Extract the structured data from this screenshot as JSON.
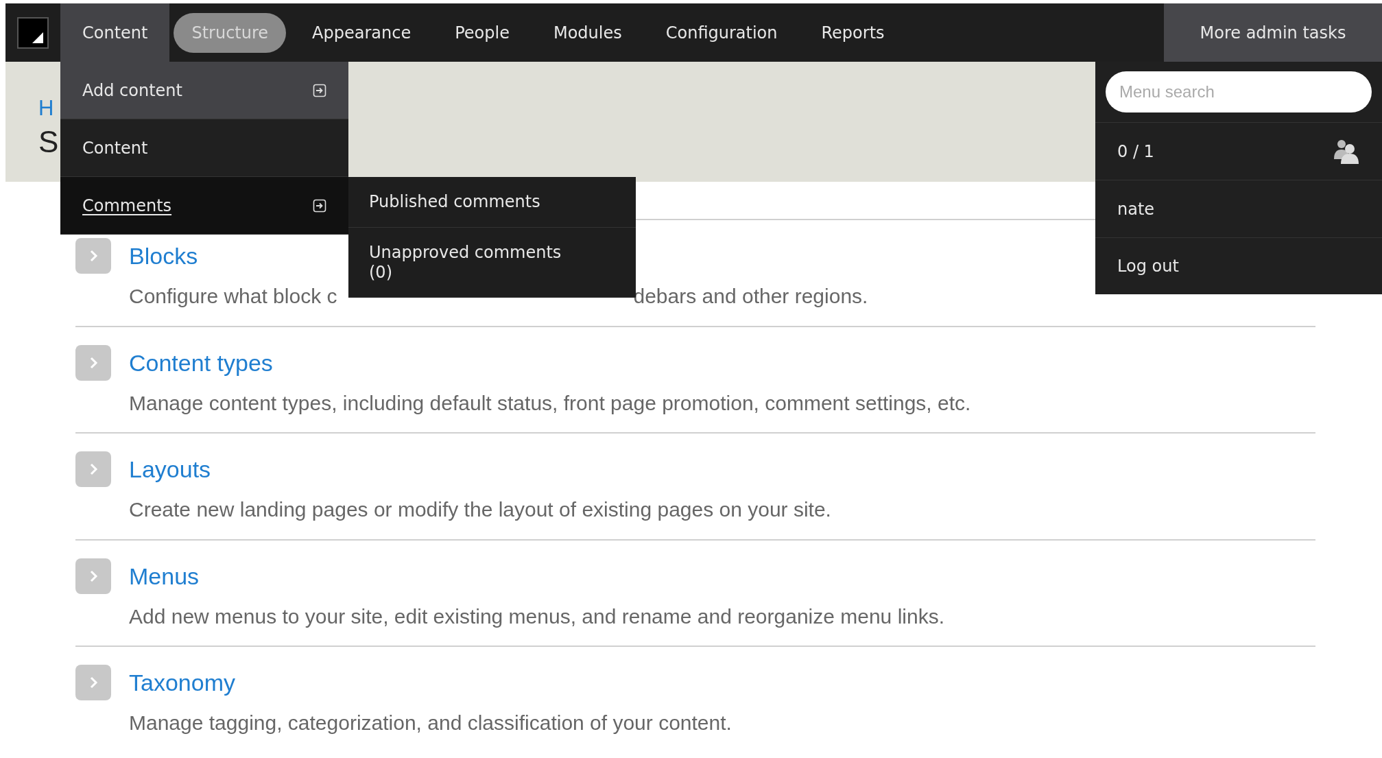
{
  "toolbar": {
    "tabs": [
      {
        "label": "Content",
        "selected": false,
        "expanded": true
      },
      {
        "label": "Structure",
        "selected": true,
        "expanded": false
      },
      {
        "label": "Appearance",
        "selected": false,
        "expanded": false
      },
      {
        "label": "People",
        "selected": false,
        "expanded": false
      },
      {
        "label": "Modules",
        "selected": false,
        "expanded": false
      },
      {
        "label": "Configuration",
        "selected": false,
        "expanded": false
      },
      {
        "label": "Reports",
        "selected": false,
        "expanded": false
      }
    ],
    "more": {
      "label": "More admin tasks",
      "expanded": true
    }
  },
  "content_menu": [
    {
      "label": "Add content",
      "has_submenu": true,
      "hovered": true,
      "focused": false
    },
    {
      "label": "Content",
      "has_submenu": false,
      "hovered": false,
      "focused": false
    },
    {
      "label": "Comments",
      "has_submenu": true,
      "hovered": false,
      "focused": true
    }
  ],
  "comments_submenu": [
    {
      "label": "Published comments"
    },
    {
      "label": "Unapproved comments",
      "count": "(0)"
    }
  ],
  "user_panel": {
    "search": {
      "placeholder": "Menu search"
    },
    "sessions": "0 / 1",
    "user": "nate",
    "logout": "Log out"
  },
  "page": {
    "breadcrumb": "H",
    "title": "S",
    "items": [
      {
        "title": "Blocks",
        "description": "Configure what block c",
        "description_after": "debars and other regions."
      },
      {
        "title": "Content types",
        "description": "Manage content types, including default status, front page promotion, comment settings, etc."
      },
      {
        "title": "Layouts",
        "description": "Create new landing pages or modify the layout of existing pages on your site."
      },
      {
        "title": "Menus",
        "description": "Add new menus to your site, edit existing menus, and rename and reorganize menu links."
      },
      {
        "title": "Taxonomy",
        "description": "Manage tagging, categorization, and classification of your content."
      }
    ]
  }
}
